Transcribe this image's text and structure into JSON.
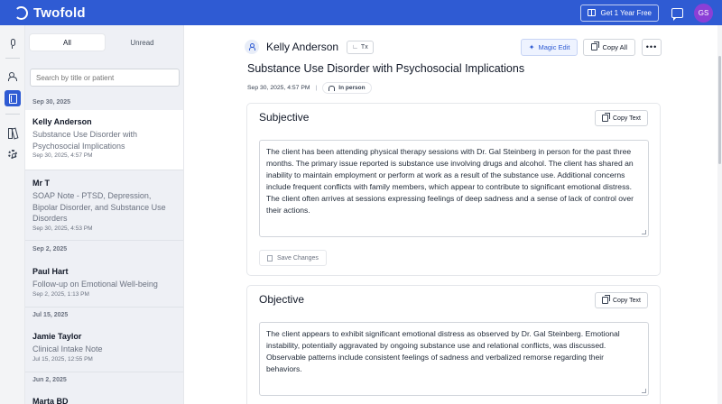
{
  "app": {
    "name": "Twofold",
    "promo_label": "Get 1 Year Free",
    "user_initials": "GS",
    "accent_color": "#2f5bd3",
    "avatar_color": "#8b3fd6"
  },
  "rail": {
    "items": [
      {
        "icon": "microphone-icon"
      },
      {
        "icon": "users-icon"
      },
      {
        "icon": "notes-icon",
        "active": true
      },
      {
        "icon": "library-icon"
      },
      {
        "icon": "gear-icon"
      }
    ]
  },
  "list": {
    "tabs": [
      {
        "label": "All",
        "active": true
      },
      {
        "label": "Unread",
        "active": false
      }
    ],
    "search_placeholder": "Search by title or patient",
    "groups": [
      {
        "date": "Sep 30, 2025"
      },
      {
        "date": "Sep 2, 2025"
      },
      {
        "date": "Jul 15, 2025"
      },
      {
        "date": "Jun 2, 2025"
      }
    ],
    "notes": [
      {
        "name": "Kelly Anderson",
        "title": "Substance Use Disorder with Psychosocial Implications",
        "time": "Sep 30, 2025, 4:57 PM",
        "selected": true
      },
      {
        "name": "Mr T",
        "title": "SOAP Note - PTSD, Depression, Bipolar Disorder, and Substance Use Disorders",
        "time": "Sep 30, 2025, 4:53 PM"
      },
      {
        "name": "Paul Hart",
        "title": "Follow-up on Emotional Well-being",
        "time": "Sep 2, 2025, 1:13 PM"
      },
      {
        "name": "Jamie Taylor",
        "title": "Clinical Intake Note",
        "time": "Jul 15, 2025, 12:55 PM"
      },
      {
        "name": "Marta BD",
        "title": "",
        "time": ""
      }
    ]
  },
  "main": {
    "patient_name": "Kelly Anderson",
    "tx_label": "Tx",
    "magic_edit_label": "Magic Edit",
    "copy_all_label": "Copy All",
    "more_label": "•••",
    "note_heading": "Substance Use Disorder with Psychosocial Implications",
    "timestamp": "Sep 30, 2025, 4:57 PM",
    "meta_separator": "|",
    "mode": "In person",
    "sections": [
      {
        "title": "Subjective",
        "copy_label": "Copy Text",
        "text": "The client has been attending physical therapy sessions with Dr. Gal Steinberg in person for the past three months. The primary issue reported is substance use involving drugs and alcohol. The client has shared an inability to maintain employment or perform at work as a result of the substance use. Additional concerns include frequent conflicts with family members, which appear to contribute to significant emotional distress. The client often arrives at sessions expressing feelings of deep sadness and a sense of lack of control over their actions.",
        "save_label": "Save Changes"
      },
      {
        "title": "Objective",
        "copy_label": "Copy Text",
        "text": "The client appears to exhibit significant emotional distress as observed by Dr. Gal Steinberg. Emotional instability, potentially aggravated by ongoing substance use and relational conflicts, was discussed. Observable patterns include consistent feelings of sadness and verbalized remorse regarding their behaviors."
      }
    ]
  }
}
